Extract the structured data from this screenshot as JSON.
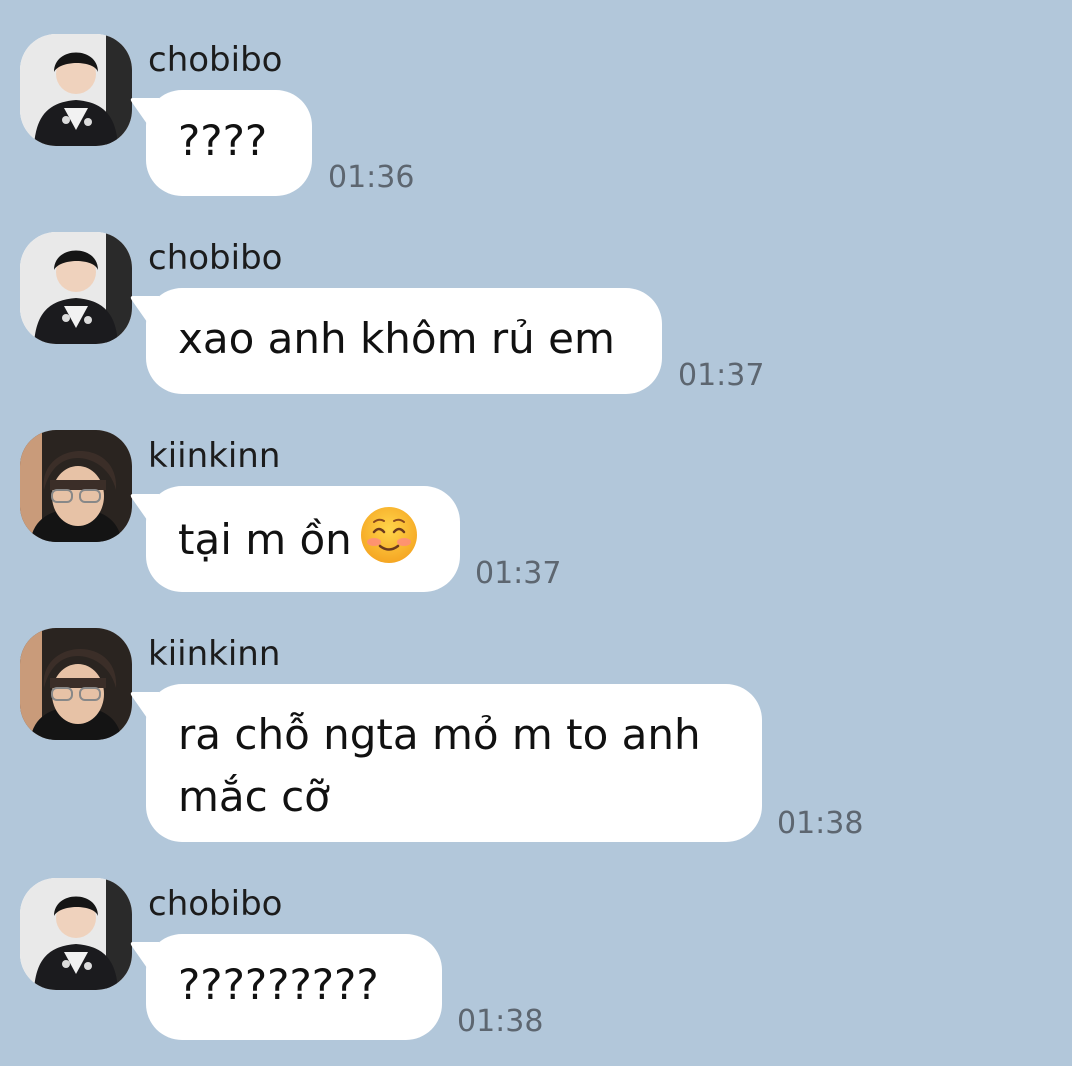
{
  "messages": [
    {
      "sender": "chobibo",
      "avatar_icon": "chobibo-avatar-icon",
      "text": "????",
      "time": "01:36"
    },
    {
      "sender": "chobibo",
      "avatar_icon": "chobibo-avatar-icon",
      "text": "xao anh khôm rủ em",
      "time": "01:37"
    },
    {
      "sender": "kiinkinn",
      "avatar_icon": "kiinkinn-avatar-icon",
      "text": "tại m ồn",
      "emoji": "smiling-face-with-smiling-eyes-icon",
      "time": "01:37"
    },
    {
      "sender": "kiinkinn",
      "avatar_icon": "kiinkinn-avatar-icon",
      "text_line1": "ra chỗ ngta mỏ m to anh",
      "text_line2": "mắc cỡ",
      "time": "01:38"
    },
    {
      "sender": "chobibo",
      "avatar_icon": "chobibo-avatar-icon",
      "text": "?????????",
      "time": "01:38"
    }
  ],
  "colors": {
    "background": "#b2c7da",
    "bubble": "#ffffff",
    "time": "#5d6670"
  }
}
